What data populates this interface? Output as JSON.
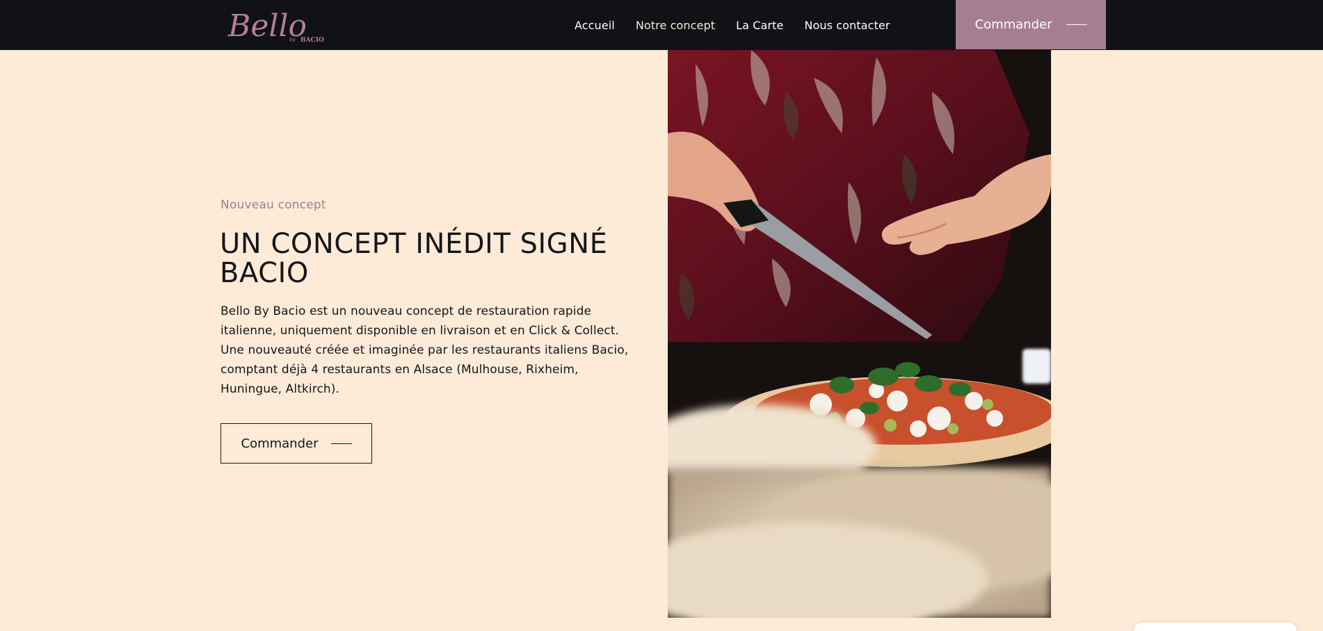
{
  "nav": {
    "logo_text": "Bello",
    "logo_sub_by": "by",
    "logo_sub_brand": "BACIO",
    "links": [
      "Accueil",
      "Notre concept",
      "La Carte",
      "Nous contacter"
    ],
    "cta": "Commander"
  },
  "hero": {
    "eyebrow": "Nouveau concept",
    "title": "UN CONCEPT INÉDIT SIGNÉ BACIO",
    "text": "Bello By Bacio est un nouveau concept de restauration rapide italienne, uniquement disponible en livraison et en Click & Collect. Une nouveauté créée et imaginée par les restaurants italiens Bacio, comptant déjà 4 restaurants en Alsace (Mulhouse, Rixheim, Huningue, Altkirch).",
    "cta": "Commander"
  },
  "photo": {
    "subject": "chef cutting a pizza"
  },
  "colors": {
    "background": "#fdebd7",
    "navbar": "#101216",
    "accent": "#a77d91",
    "text": "#14161a"
  }
}
